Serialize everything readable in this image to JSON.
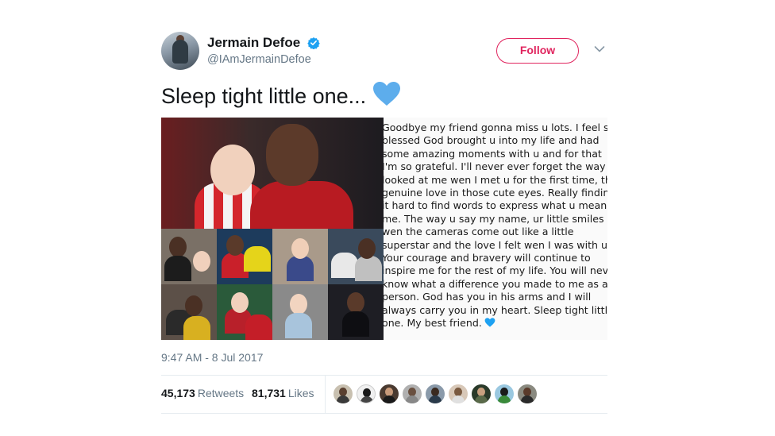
{
  "author": {
    "display_name": "Jermain Defoe",
    "handle": "@IAmJermainDefoe",
    "verified_icon": "verified-badge-icon",
    "follow_label": "Follow"
  },
  "tweet": {
    "text": "Sleep tight little one...",
    "emoji_icon": "blue-heart-icon",
    "timestamp": "9:47 AM - 8 Jul 2017"
  },
  "letter": {
    "lines": [
      "Goodbye my friend gonna miss u lots. I feel so",
      "blessed God brought u into my life and had",
      "some amazing moments with u and for that",
      "I'm so grateful. I'll never ever forget the way u",
      "looked at me wen I met u for the first time, the",
      "genuine love in those cute eyes. Really finding",
      "it hard to find words to express what u mean to",
      "me. The way u say my name, ur little smiles",
      "wen the cameras come out like a little",
      "superstar and the love I felt wen I was with u.",
      "Your courage and bravery will continue to",
      "inspire me for the rest of my life. You will never",
      "know what a difference you made to me as a",
      "person. God has you in his arms and I will",
      "always carry you in my heart. Sleep tight little",
      "one. My best friend."
    ]
  },
  "stats": {
    "retweets_count": "45,173",
    "retweets_label": "Retweets",
    "likes_count": "81,731",
    "likes_label": "Likes"
  },
  "colors": {
    "follow_accent": "#e0245e",
    "verified_blue": "#1da1f2",
    "heart_blue": "#5dadec",
    "muted_text": "#657786"
  }
}
